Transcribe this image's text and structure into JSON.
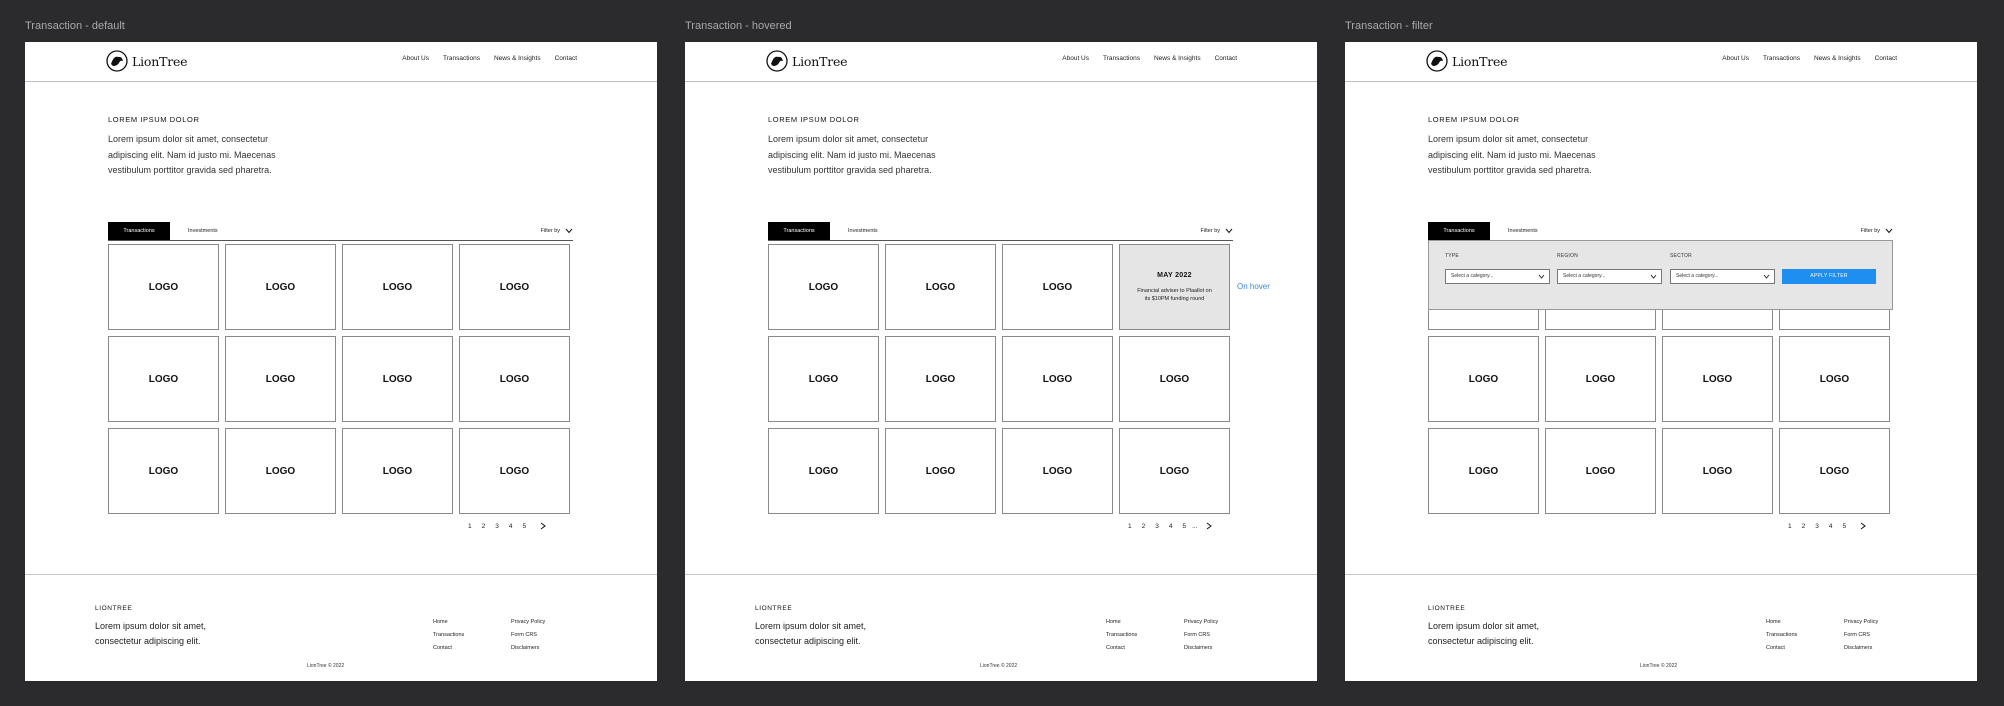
{
  "frames": [
    {
      "title": "Transaction - default"
    },
    {
      "title": "Transaction - hovered"
    },
    {
      "title": "Transaction - filter"
    }
  ],
  "brand": {
    "name": "LionTree"
  },
  "nav": {
    "links": [
      "About Us",
      "Transactions",
      "News & Insights",
      "Contact"
    ]
  },
  "hero": {
    "eyebrow": "LOREM IPSUM DOLOR",
    "text": "Lorem ipsum dolor sit amet, consectetur adipiscing elit. Nam id justo mi. Maecenas vestibulum porttitor gravida sed pharetra.",
    "text_filter": "Lorem ipsum dolor sit amet, consectetur adipiscing elit. Nam id justo mi. Maecenas vestibulum porttitor gravida sed pharetra."
  },
  "tabs": {
    "transactions": "Transactions",
    "investments": "Investments",
    "filter_by": "Filter by"
  },
  "tile": {
    "logo": "LOGO"
  },
  "hover_card": {
    "date": "MAY 2022",
    "desc": "Financial adviser to Plaallot on its $10PM funding round",
    "annotation": "On hover"
  },
  "pagination": {
    "default": [
      "1",
      "2",
      "3",
      "4",
      "5"
    ],
    "hovered": [
      "1",
      "2",
      "3",
      "4",
      "5",
      "..."
    ]
  },
  "filter_panel": {
    "type_label": "TYPE",
    "region_label": "REGION",
    "sector_label": "SECTOR",
    "placeholder": "Select a category...",
    "apply": "APPLY FILTER",
    "apply_color": "#1f8ef1"
  },
  "footer": {
    "brand": "LIONTREE",
    "tagline": "Lorem ipsum dolor sit amet, consectetur adipiscing elit.",
    "col1": [
      "Home",
      "Transactions",
      "Contact"
    ],
    "col2": [
      "Privacy Policy",
      "Form CRS",
      "Disclaimers"
    ],
    "copyright": "LionTree © 2022"
  }
}
